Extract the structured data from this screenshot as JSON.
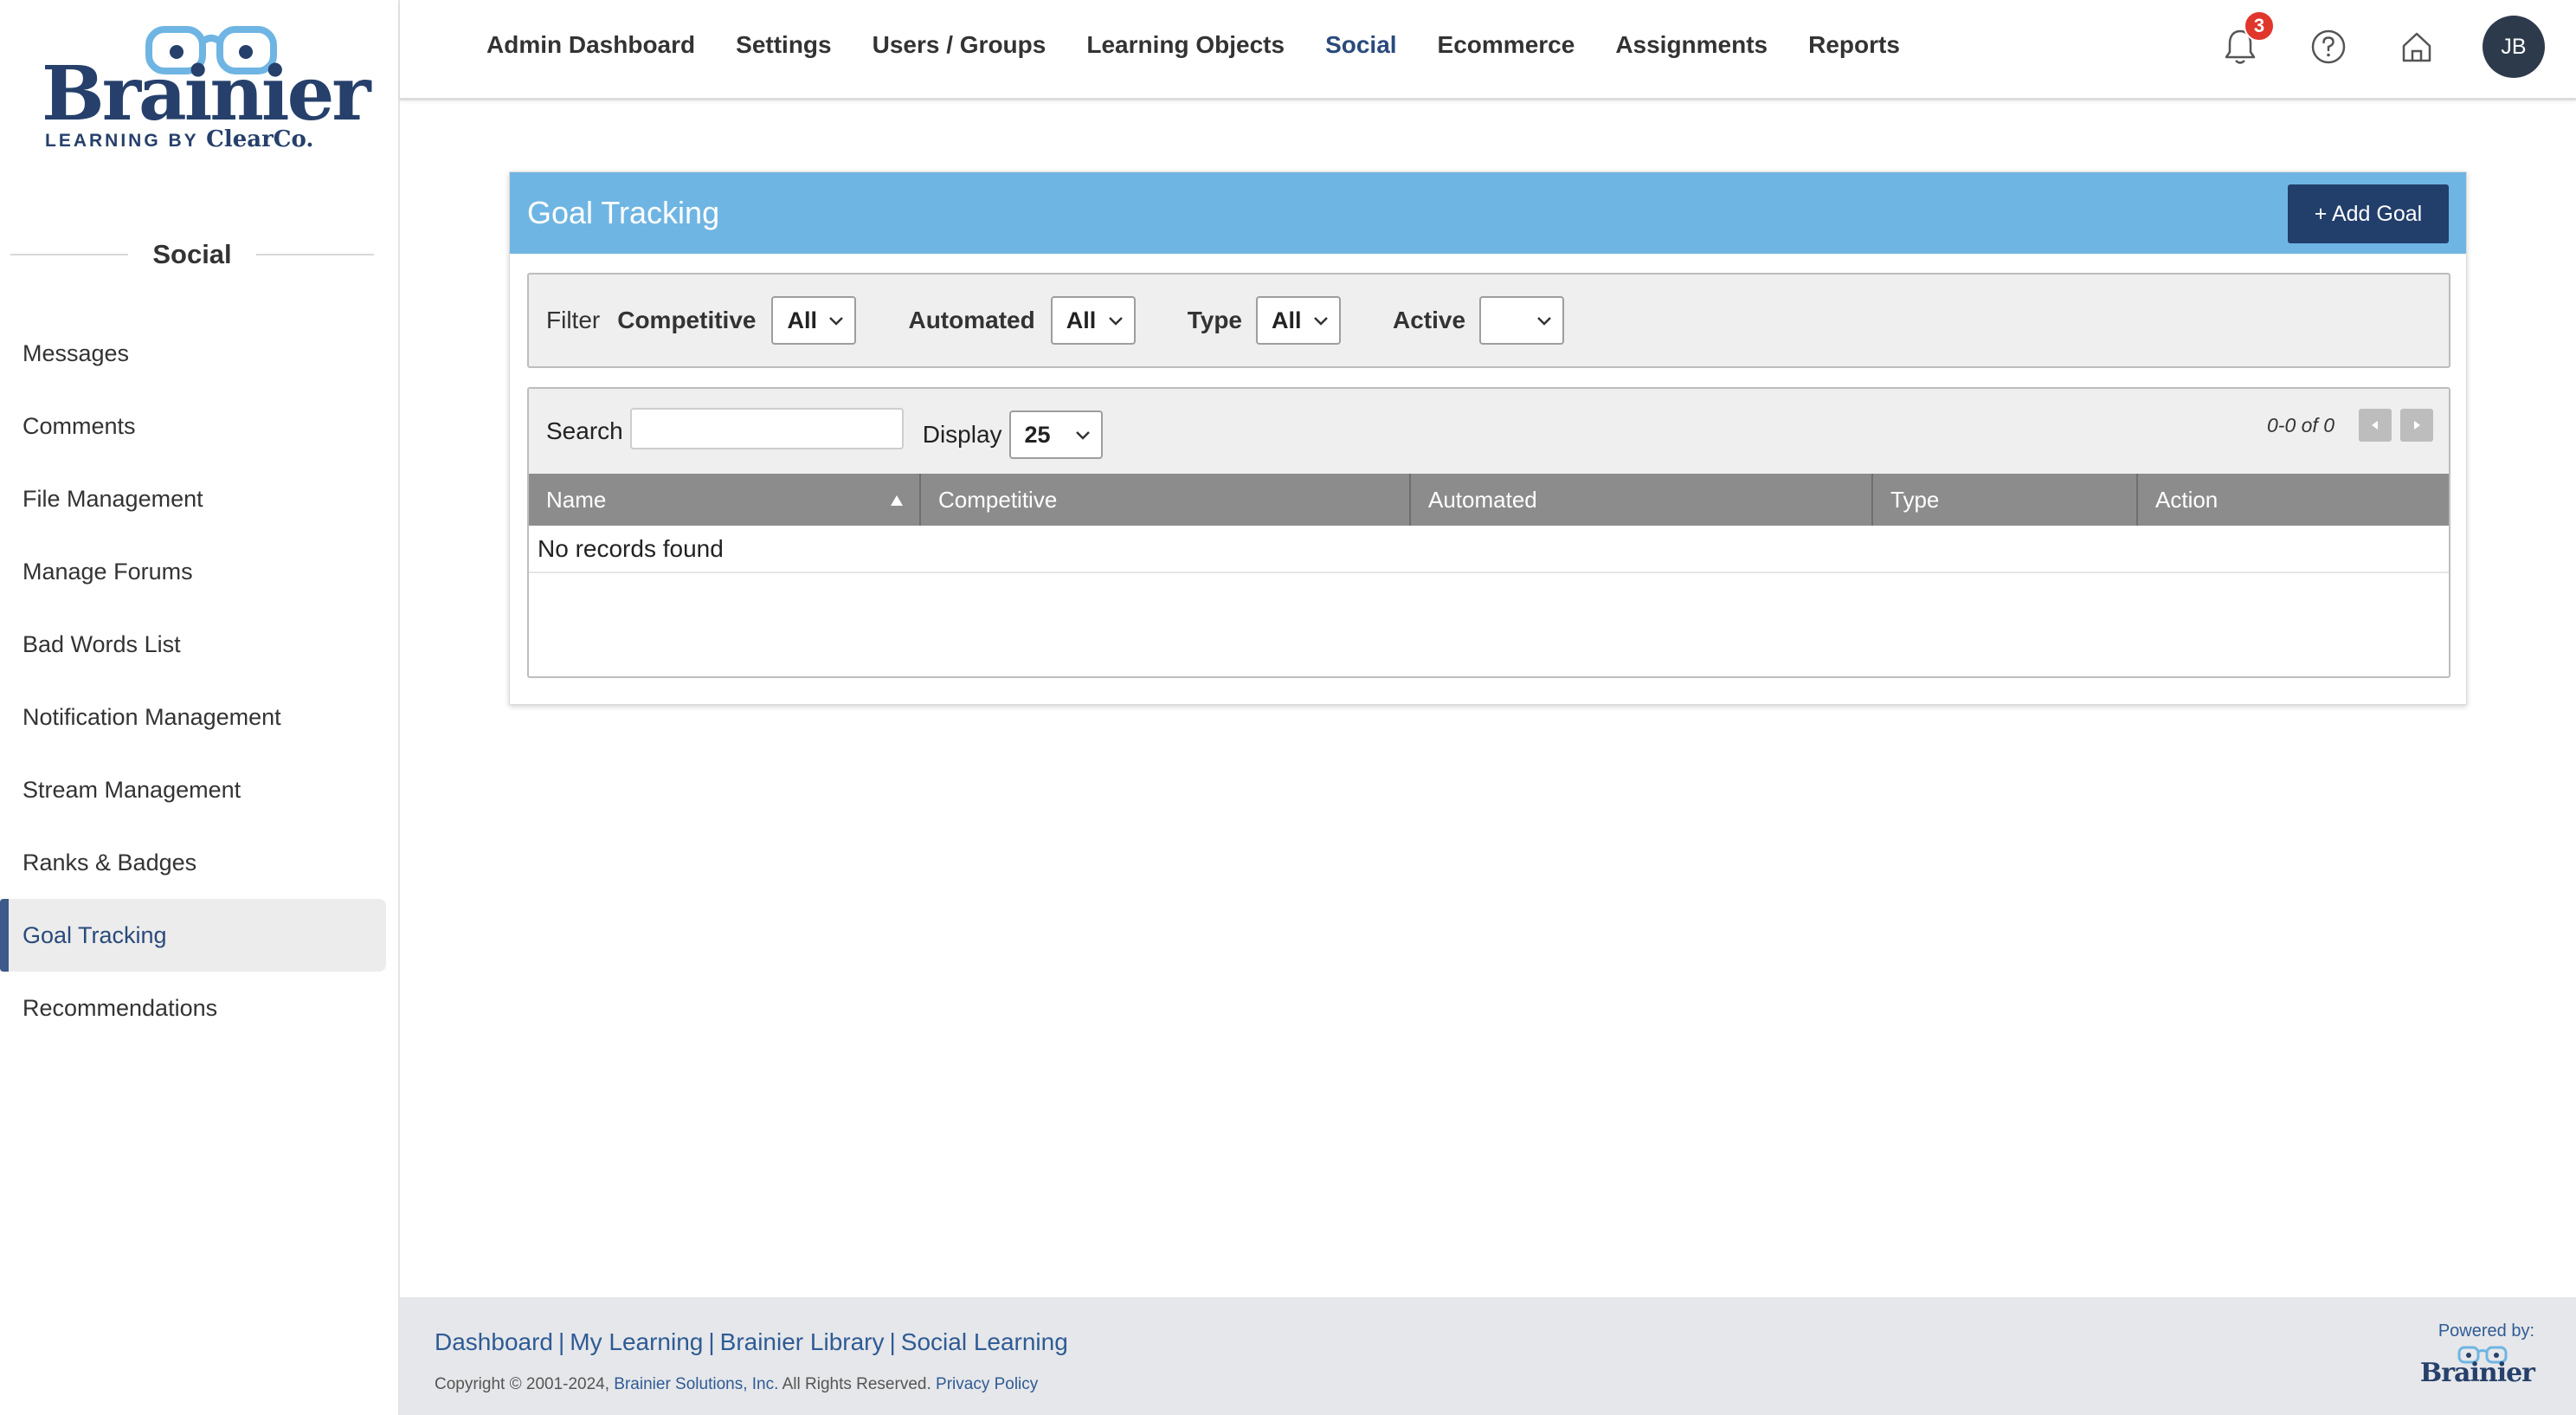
{
  "brand": {
    "name": "Brainier",
    "tagline_prefix": "LEARNING BY",
    "tagline_company": "ClearCo.",
    "primary_color": "#26406b",
    "accent_color": "#6fb5e3"
  },
  "sidebar": {
    "heading": "Social",
    "items": [
      {
        "label": "Messages"
      },
      {
        "label": "Comments"
      },
      {
        "label": "File Management"
      },
      {
        "label": "Manage Forums"
      },
      {
        "label": "Bad Words List"
      },
      {
        "label": "Notification Management"
      },
      {
        "label": "Stream Management"
      },
      {
        "label": "Ranks & Badges"
      },
      {
        "label": "Goal Tracking",
        "active": true
      },
      {
        "label": "Recommendations"
      }
    ]
  },
  "topnav": {
    "items": [
      {
        "label": "Admin Dashboard"
      },
      {
        "label": "Settings"
      },
      {
        "label": "Users / Groups"
      },
      {
        "label": "Learning Objects"
      },
      {
        "label": "Social",
        "active": true
      },
      {
        "label": "Ecommerce"
      },
      {
        "label": "Assignments"
      },
      {
        "label": "Reports"
      }
    ],
    "notification_count": "3",
    "icons": [
      "bell-icon",
      "help-icon",
      "home-icon"
    ],
    "avatar_initials": "JB"
  },
  "card": {
    "title": "Goal Tracking",
    "add_button": "+ Add Goal"
  },
  "filter": {
    "label": "Filter",
    "fields": [
      {
        "label": "Competitive",
        "value": "All"
      },
      {
        "label": "Automated",
        "value": "All"
      },
      {
        "label": "Type",
        "value": "All"
      },
      {
        "label": "Active",
        "value": ""
      }
    ]
  },
  "list": {
    "search_label": "Search",
    "search_value": "",
    "display_label": "Display",
    "display_value": "25",
    "pager_text": "0-0 of 0",
    "columns": [
      "Name",
      "Competitive",
      "Automated",
      "Type",
      "Action"
    ],
    "sorted_column": "Name",
    "empty_message": "No records found"
  },
  "footer": {
    "links": [
      "Dashboard",
      "My Learning",
      "Brainier Library",
      "Social Learning"
    ],
    "copyright_prefix": "Copyright © 2001-2024, ",
    "company": "Brainier Solutions, Inc.",
    "rights": " All Rights Reserved. ",
    "privacy": "Privacy Policy",
    "powered_by": "Powered by:",
    "powered_logo": "Brainier"
  }
}
